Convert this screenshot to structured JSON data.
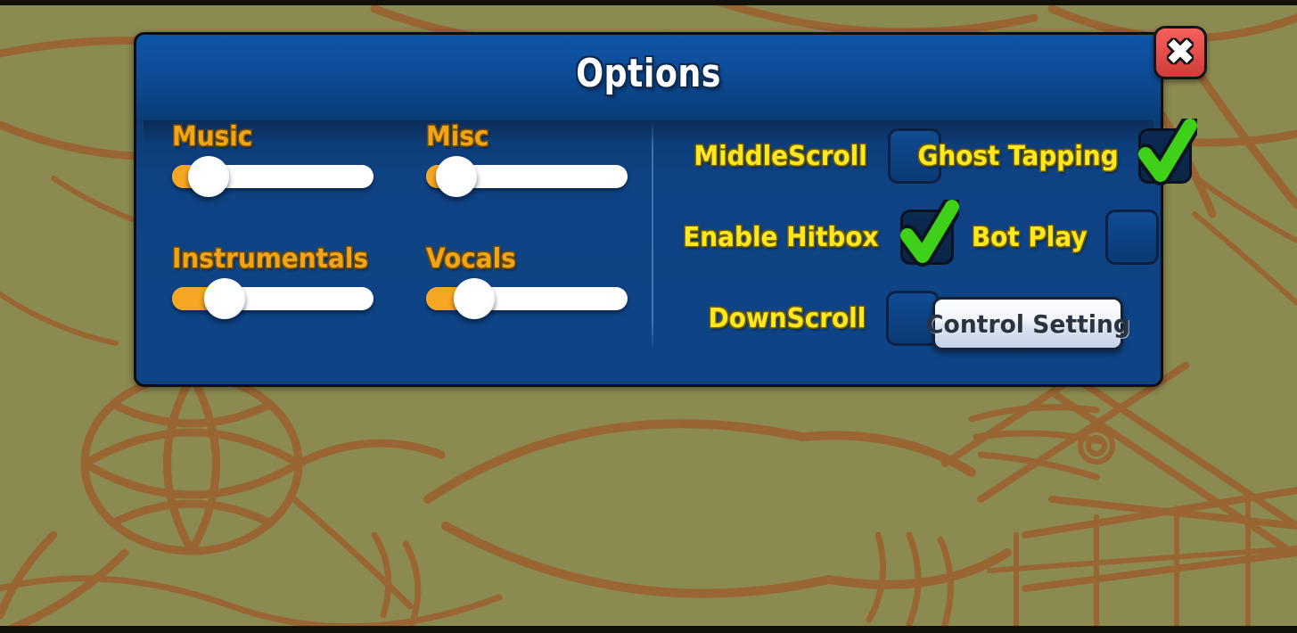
{
  "dialog": {
    "title": "Options",
    "close_label": "✖",
    "close_icon": "close-x-icon"
  },
  "accent_colors": {
    "panel_blue": "#0e4486",
    "header_blue": "#0f55a8",
    "slider_label_orange": "#f0a519",
    "toggle_label_yellow": "#ffe81f",
    "slider_fill_orange": "#f5a623",
    "check_green": "#3fd119",
    "close_red": "#e8504c",
    "background_olive": "#8b8a50",
    "background_sketch_brown": "#9c5f2e"
  },
  "sliders": [
    {
      "name": "music",
      "label": "Music",
      "value_percent": 18
    },
    {
      "name": "misc",
      "label": "Misc",
      "value_percent": 15
    },
    {
      "name": "instrumentals",
      "label": "Instrumentals",
      "value_percent": 26
    },
    {
      "name": "vocals",
      "label": "Vocals",
      "value_percent": 24
    }
  ],
  "toggles": [
    {
      "name": "middlescroll",
      "label": "MiddleScroll",
      "checked": false
    },
    {
      "name": "ghost-tapping",
      "label": "Ghost Tapping",
      "checked": true
    },
    {
      "name": "enable-hitbox",
      "label": "Enable Hitbox",
      "checked": true
    },
    {
      "name": "bot-play",
      "label": "Bot Play",
      "checked": false
    },
    {
      "name": "downscroll",
      "label": "DownScroll",
      "checked": false
    }
  ],
  "buttons": {
    "control_setting": "Control Setting"
  }
}
